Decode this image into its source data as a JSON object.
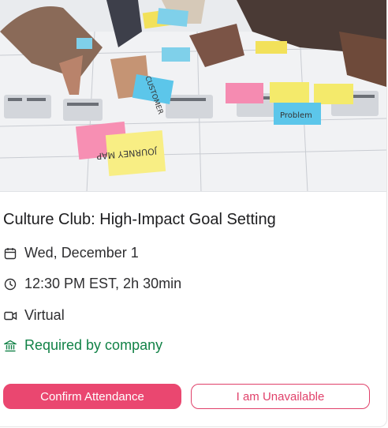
{
  "event": {
    "title": "Culture Club: High-Impact Goal Setting",
    "date": "Wed, December 1",
    "time": "12:30 PM EST, 2h 30min",
    "location": "Virtual",
    "requirement": "Required by company"
  },
  "photo": {
    "sticky_notes": [
      "CUSTOMER",
      "JOURNEY MAP",
      "Problem"
    ]
  },
  "actions": {
    "confirm_label": "Confirm Attendance",
    "unavailable_label": "I am Unavailable"
  },
  "icons": {
    "date": "calendar-icon",
    "time": "clock-icon",
    "location": "video-camera-icon",
    "requirement": "bank-building-icon"
  },
  "colors": {
    "accent": "#ea4770",
    "required": "#128247",
    "text": "#1d1d1f"
  }
}
